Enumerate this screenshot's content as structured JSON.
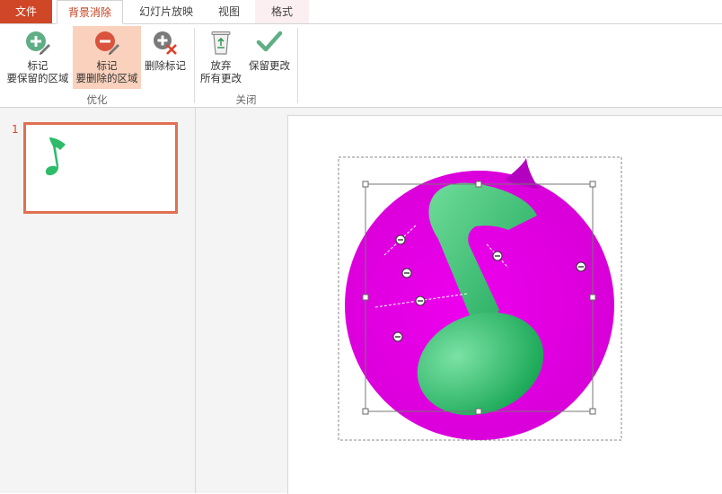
{
  "tabs": {
    "file": "文件",
    "background_removal": "背景消除",
    "slideshow": "幻灯片放映",
    "view": "视图",
    "format": "格式"
  },
  "ribbon": {
    "mark_keep": {
      "line1": "标记",
      "line2": "要保留的区域"
    },
    "mark_remove": {
      "line1": "标记",
      "line2": "要删除的区域"
    },
    "delete_mark": "删除标记",
    "discard": {
      "line1": "放弃",
      "line2": "所有更改"
    },
    "keep_changes": "保留更改",
    "group_refine": "优化",
    "group_close": "关闭"
  },
  "slides": {
    "current_number": "1"
  },
  "colors": {
    "file_tab": "#d04727",
    "active_tab_text": "#c43e1c",
    "selected_button": "#f9d1bd",
    "thumbnail_border": "#e07050",
    "magenta": "#e600e6",
    "note_green": "#2ebc6a"
  },
  "icons": {
    "mark_keep": "plus-circle-pencil-icon",
    "mark_remove": "minus-circle-pencil-icon",
    "delete_mark": "plus-circle-x-icon",
    "discard": "recycle-bin-icon",
    "keep_changes": "checkmark-icon"
  }
}
